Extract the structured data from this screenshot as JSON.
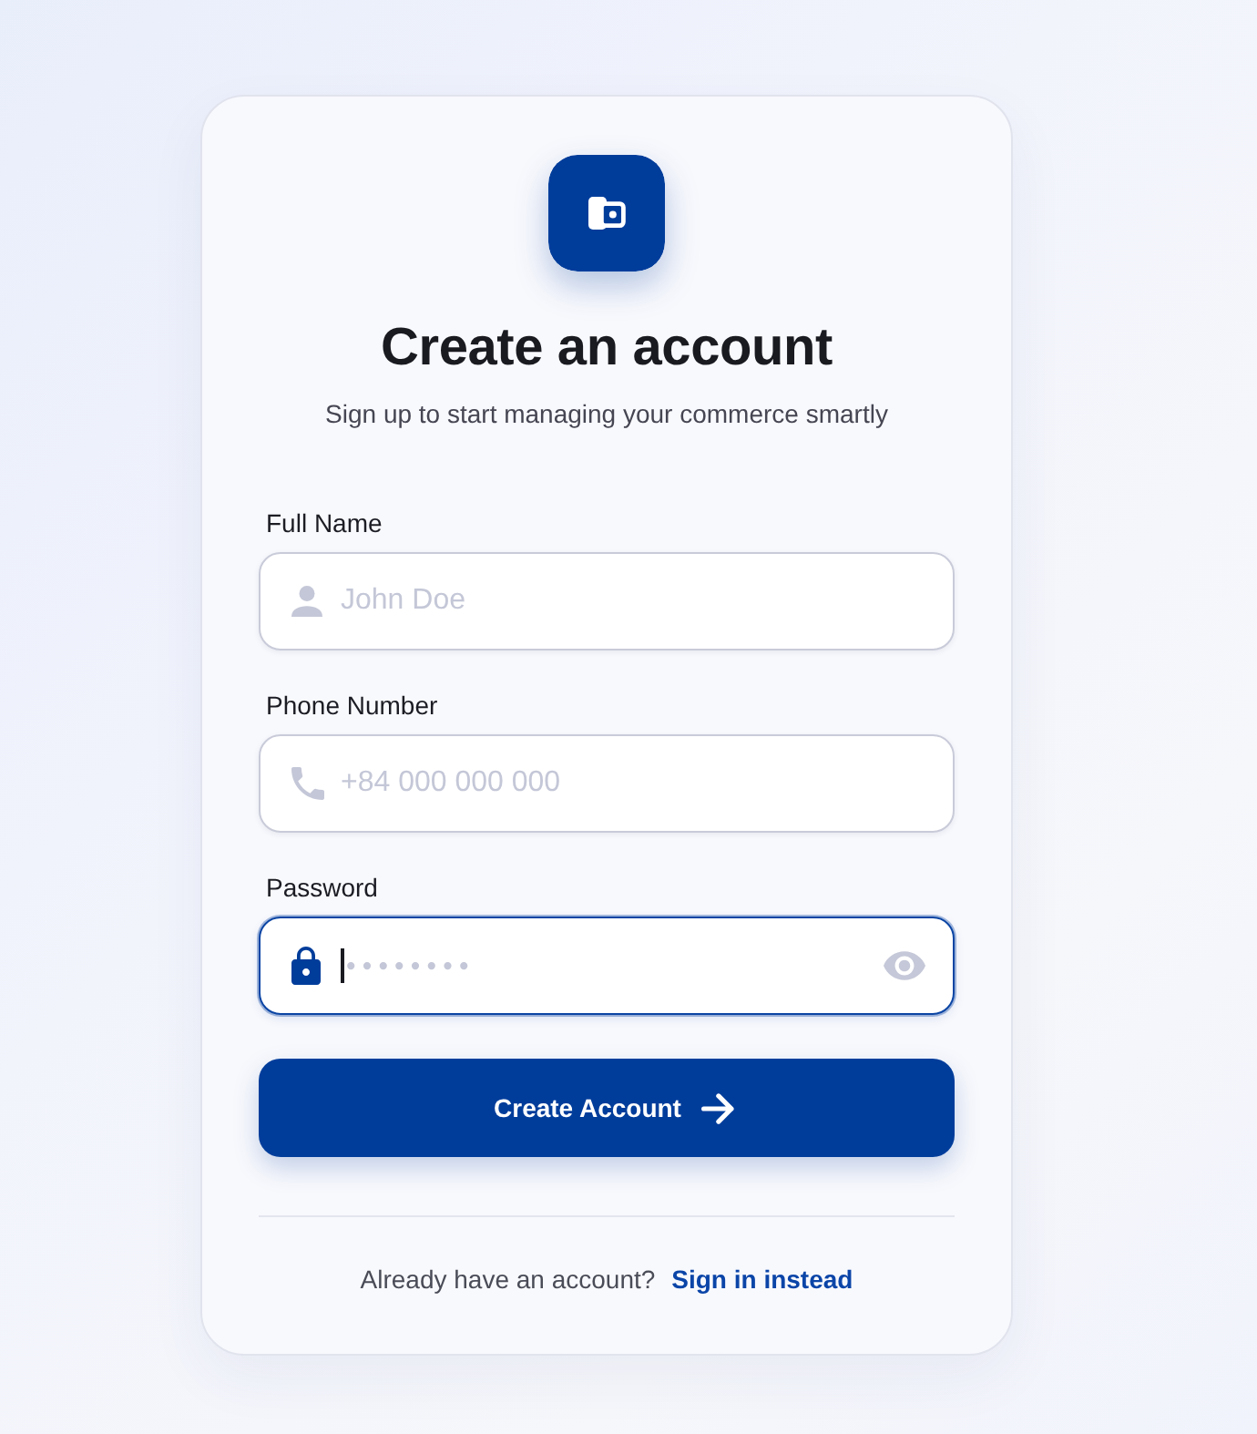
{
  "header": {
    "title": "Create an account",
    "subtitle": "Sign up to start managing your commerce smartly"
  },
  "fields": [
    {
      "kind": "name",
      "label": "Full Name",
      "placeholder": "John Doe",
      "focused": false
    },
    {
      "kind": "phone",
      "label": "Phone Number",
      "placeholder": "+84 000 000 000",
      "focused": false
    },
    {
      "kind": "password",
      "label": "Password",
      "placeholder": "••••••••",
      "focused": true
    }
  ],
  "submit_button": {
    "label": "Create Account"
  },
  "footer": {
    "prompt": "Already have an account?",
    "link": "Sign in instead"
  }
}
